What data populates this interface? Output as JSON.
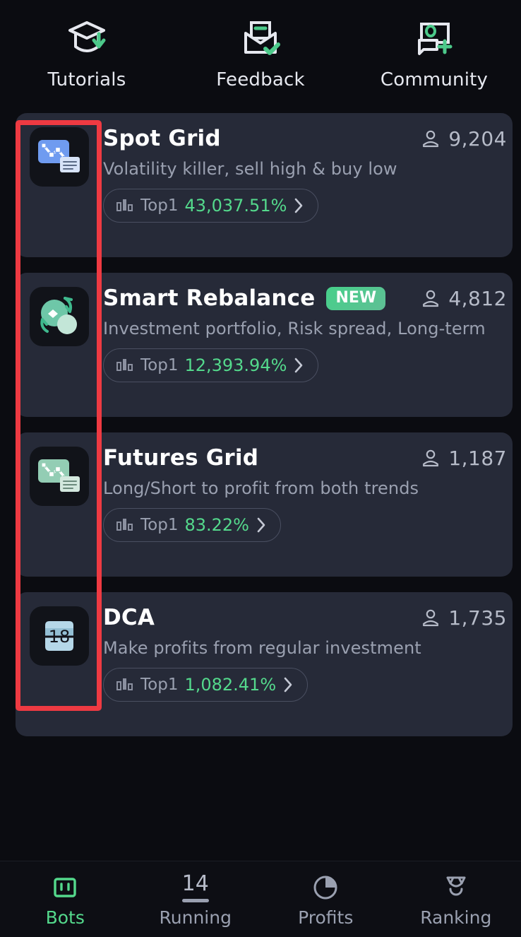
{
  "quicklinks": [
    {
      "label": "Tutorials",
      "icon": "graduation-cap-download-icon"
    },
    {
      "label": "Feedback",
      "icon": "envelope-check-icon"
    },
    {
      "label": "Community",
      "icon": "chat-bubbles-plus-icon"
    }
  ],
  "bots": [
    {
      "title": "Spot Grid",
      "badge": "",
      "desc": "Volatility killer, sell high & buy low",
      "rank_label": "Top1",
      "rank_value": "43,037.51%",
      "users": "9,204",
      "icon": "spot-grid-chart-icon",
      "icon_color": "#6f9bf0"
    },
    {
      "title": "Smart Rebalance",
      "badge": "NEW",
      "desc": "Investment portfolio, Risk spread, Long-term",
      "rank_label": "Top1",
      "rank_value": "12,393.94%",
      "users": "4,812",
      "icon": "rebalance-circles-icon",
      "icon_color": "#6ec7a8"
    },
    {
      "title": "Futures Grid",
      "badge": "",
      "desc": "Long/Short to profit from both trends",
      "rank_label": "Top1",
      "rank_value": "83.22%",
      "users": "1,187",
      "icon": "futures-grid-chart-icon",
      "icon_color": "#93cdb4"
    },
    {
      "title": "DCA",
      "badge": "",
      "desc": "Make profits from regular investment",
      "rank_label": "Top1",
      "rank_value": "1,082.41%",
      "users": "1,735",
      "icon": "calendar-18-icon",
      "icon_color": "#b5d7e8"
    }
  ],
  "tabbar": [
    {
      "label": "Bots",
      "icon": "bots-icon",
      "active": true,
      "badge": ""
    },
    {
      "label": "Running",
      "icon": "running-count-icon",
      "active": false,
      "badge": "14"
    },
    {
      "label": "Profits",
      "icon": "pie-chart-icon",
      "active": false,
      "badge": ""
    },
    {
      "label": "Ranking",
      "icon": "medal-icon",
      "active": false,
      "badge": ""
    }
  ],
  "colors": {
    "accent_green": "#54d98c",
    "annotation_red": "#ee3a42",
    "card_bg": "#262a38",
    "page_bg": "#0b0c11"
  }
}
